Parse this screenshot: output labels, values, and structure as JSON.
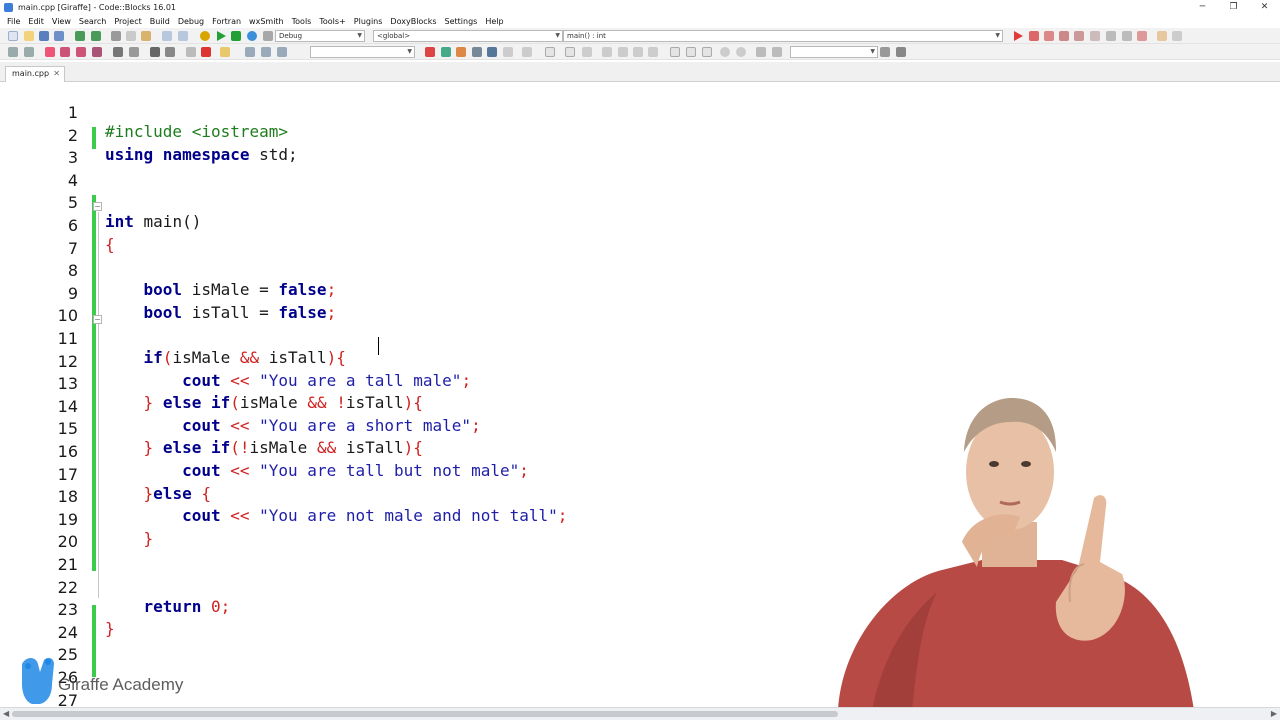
{
  "window": {
    "title": "main.cpp [Giraffe] - Code::Blocks 16.01",
    "minimize_glyph": "─",
    "restore_glyph": "❐",
    "close_glyph": "✕"
  },
  "menu": [
    "File",
    "Edit",
    "View",
    "Search",
    "Project",
    "Build",
    "Debug",
    "Fortran",
    "wxSmith",
    "Tools",
    "Tools+",
    "Plugins",
    "DoxyBlocks",
    "Settings",
    "Help"
  ],
  "toolbar": {
    "build_target": "Debug",
    "scope": "<global>",
    "function": "main() : int"
  },
  "tab": {
    "label": "main.cpp",
    "close_glyph": "✕"
  },
  "editor": {
    "line_numbers": [
      "1",
      "2",
      "3",
      "4",
      "5",
      "6",
      "7",
      "8",
      "9",
      "10",
      "11",
      "12",
      "13",
      "14",
      "15",
      "16",
      "17",
      "18",
      "19",
      "20",
      "21",
      "22",
      "23",
      "24",
      "25",
      "26",
      "27"
    ]
  },
  "watermark": {
    "text": "Giraffe Academy"
  },
  "colors": {
    "keyword": "#00008b",
    "preprocessor": "#1e7d1e",
    "string": "#1e1ea8",
    "operator": "#d02020",
    "changed_line_marker": "#3ccc4c"
  }
}
